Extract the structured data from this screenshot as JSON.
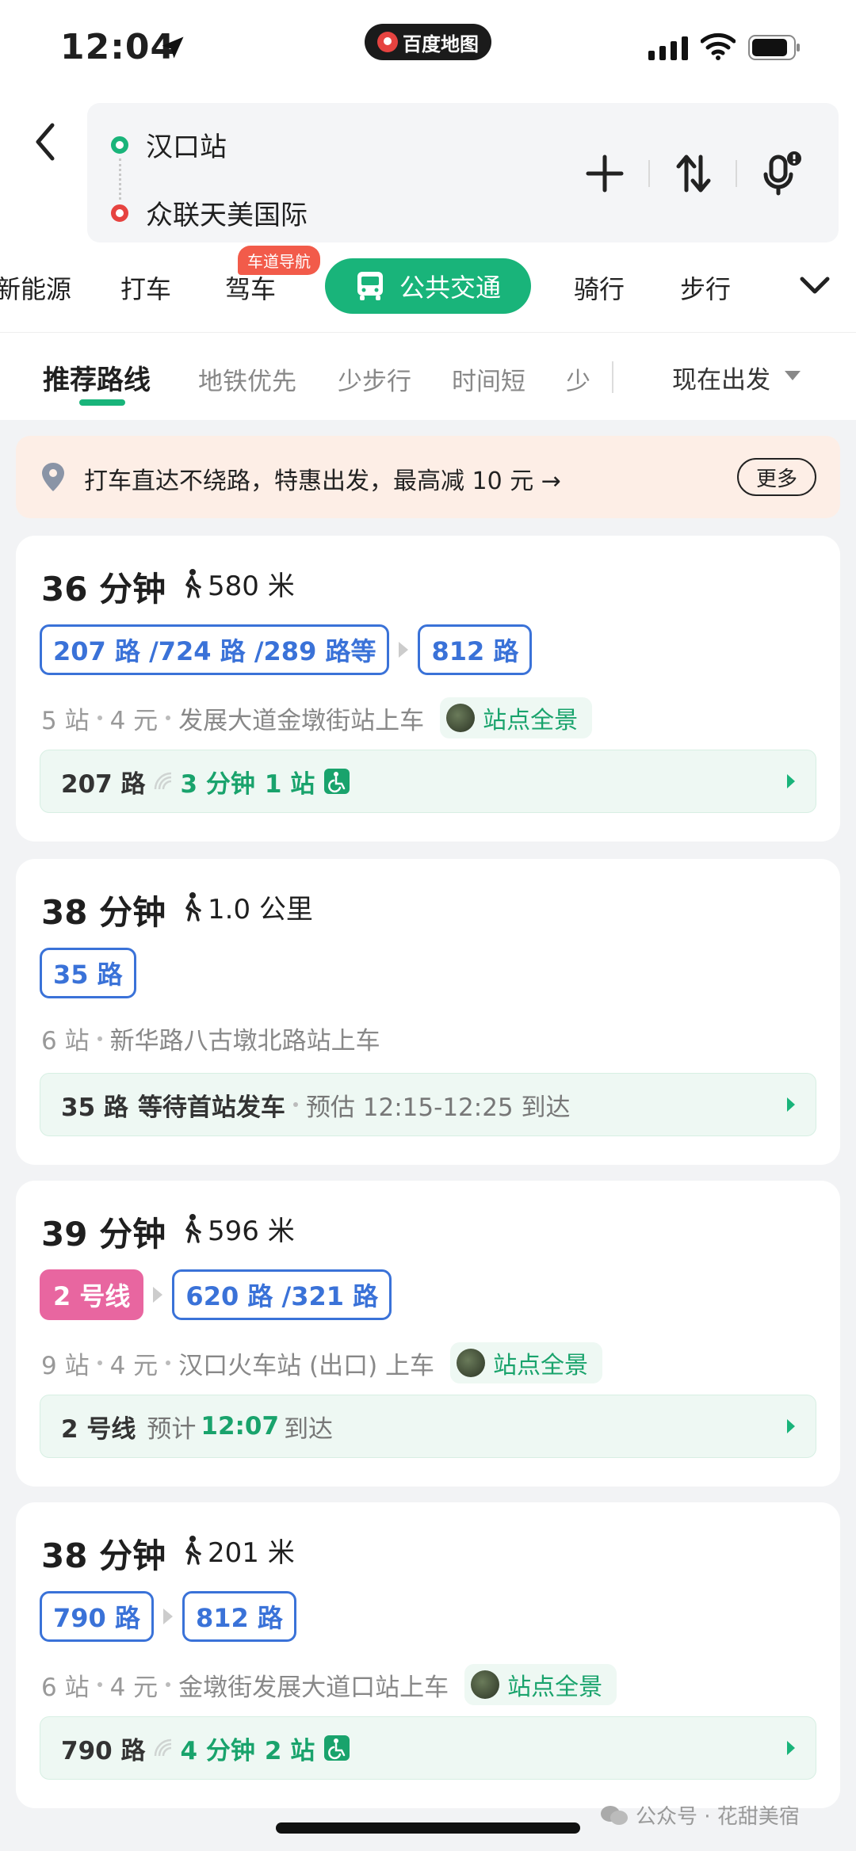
{
  "status_bar": {
    "time": "12:04",
    "app_name": "百度地图"
  },
  "header": {
    "origin": "汉口站",
    "destination": "众联天美国际"
  },
  "modes": {
    "items": [
      "新能源",
      "打车",
      "驾车",
      "公共交通",
      "骑行",
      "步行"
    ],
    "active": "公共交通",
    "badge": "车道导航"
  },
  "sub_tabs": {
    "items": [
      "推荐路线",
      "地铁优先",
      "少步行",
      "时间短",
      "少"
    ],
    "depart": "现在出发"
  },
  "promo": {
    "text": "打车直达不绕路，特惠出发，最高减 10 元 →",
    "more": "更多"
  },
  "cards": [
    {
      "duration": "36 分钟",
      "walk": "580 米",
      "lines": [
        "207 路 /724 路 /289 路等",
        "812 路"
      ],
      "stops": "5 站",
      "fare": "4 元",
      "board": "发展大道金墩街站上车",
      "pano": "站点全景",
      "rt": {
        "line": "207 路",
        "eta": "3 分钟",
        "stops_away": "1 站"
      }
    },
    {
      "duration": "38 分钟",
      "walk": "1.0 公里",
      "lines": [
        "35 路"
      ],
      "stops": "6 站",
      "board": "新华路八古墩北路站上车",
      "rt": {
        "line": "35 路",
        "status": "等待首站发车",
        "est": "预估 12:15-12:25 到达"
      }
    },
    {
      "duration": "39 分钟",
      "walk": "596 米",
      "lines": [
        "2 号线",
        "620 路 /321 路"
      ],
      "stops": "9 站",
      "fare": "4 元",
      "board": "汉口火车站 (出口) 上车",
      "pano": "站点全景",
      "rt": {
        "line": "2 号线",
        "pre": "预计",
        "time": "12:07",
        "post": "到达"
      }
    },
    {
      "duration": "38 分钟",
      "walk": "201 米",
      "lines": [
        "790 路",
        "812 路"
      ],
      "stops": "6 站",
      "fare": "4 元",
      "board": "金墩街发展大道口站上车",
      "pano": "站点全景",
      "rt": {
        "line": "790 路",
        "eta": "4 分钟",
        "stops_away": "2 站"
      }
    }
  ],
  "watermark": "公众号 · 花甜美宿",
  "colors": {
    "accent": "#19b47a",
    "line_blue": "#3a72d8",
    "metro_pink": "#e866a0",
    "promo_bg": "#fdeee6"
  }
}
